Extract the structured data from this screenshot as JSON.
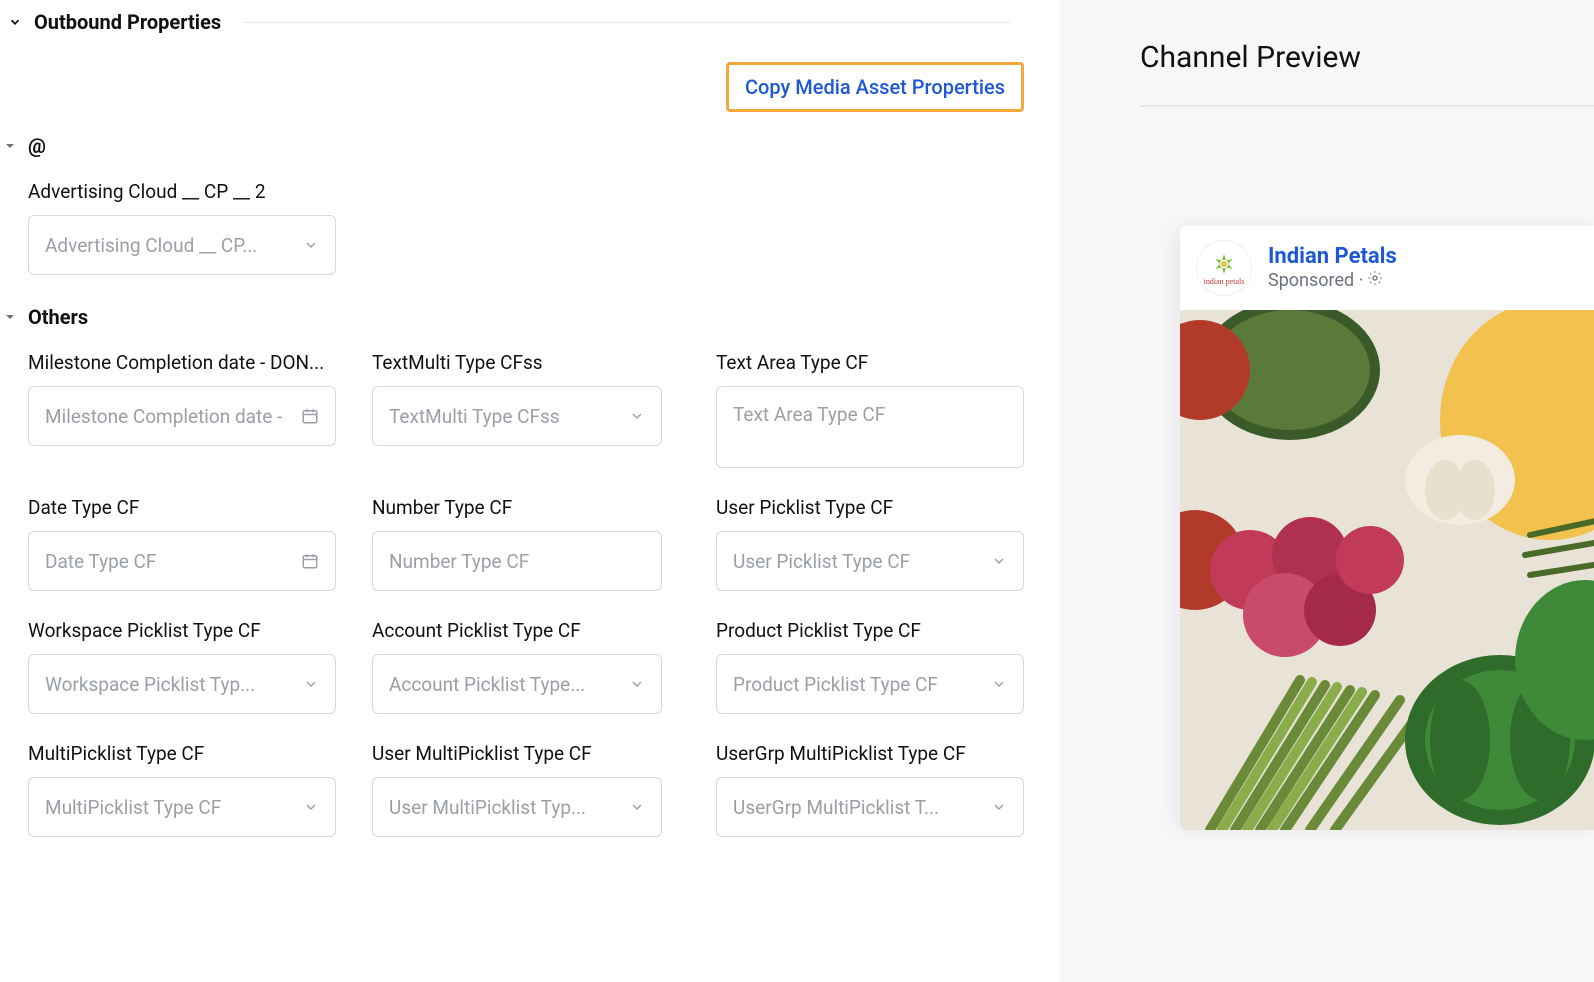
{
  "section_title": "Outbound Properties",
  "copy_button": "Copy Media Asset Properties",
  "group_at": {
    "title": "@",
    "field1": {
      "label": "Advertising Cloud __ CP __ 2",
      "placeholder": "Advertising Cloud __ CP..."
    }
  },
  "group_others": {
    "title": "Others",
    "rows": [
      {
        "col1": {
          "label": "Milestone Completion date - DON...",
          "placeholder": "Milestone Completion date -",
          "type": "date"
        },
        "col2": {
          "label": "TextMulti Type CFss",
          "placeholder": "TextMulti Type CFss",
          "type": "select"
        },
        "col3": {
          "label": "Text Area Type CF",
          "placeholder": "Text Area Type CF",
          "type": "textarea"
        }
      },
      {
        "col1": {
          "label": "Date Type CF",
          "placeholder": "Date Type CF",
          "type": "date"
        },
        "col2": {
          "label": "Number Type CF",
          "placeholder": "Number Type CF",
          "type": "number"
        },
        "col3": {
          "label": "User Picklist Type CF",
          "placeholder": "User Picklist Type CF",
          "type": "select"
        }
      },
      {
        "col1": {
          "label": "Workspace Picklist Type CF",
          "placeholder": "Workspace Picklist Typ...",
          "type": "select"
        },
        "col2": {
          "label": "Account Picklist Type CF",
          "placeholder": "Account Picklist Type...",
          "type": "select"
        },
        "col3": {
          "label": "Product Picklist Type CF",
          "placeholder": "Product Picklist Type CF",
          "type": "select"
        }
      },
      {
        "col1": {
          "label": "MultiPicklist Type CF",
          "placeholder": "MultiPicklist Type CF",
          "type": "select"
        },
        "col2": {
          "label": "User MultiPicklist Type CF",
          "placeholder": "User MultiPicklist Typ...",
          "type": "select"
        },
        "col3": {
          "label": "UserGrp MultiPicklist Type CF",
          "placeholder": "UserGrp MultiPicklist T...",
          "type": "select"
        }
      }
    ]
  },
  "preview": {
    "title": "Channel Preview",
    "brand": "Indian Petals",
    "sponsored": "Sponsored ·",
    "avatar_label": "indian petals"
  }
}
